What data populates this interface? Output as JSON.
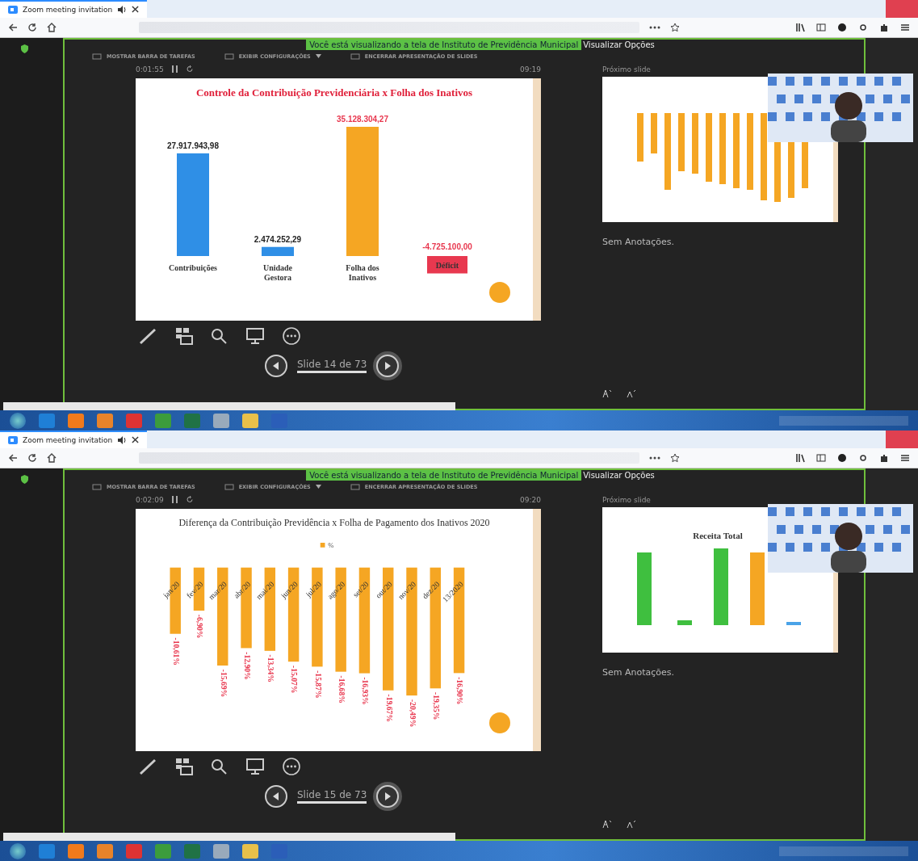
{
  "screens": [
    {
      "browser": {
        "tab_title": "Zoom meeting invitation"
      },
      "share_banner": "Você está visualizando a tela de Instituto de Previdência Municipal",
      "view_options": "Visualizar Opções",
      "controls": [
        "MOSTRAR BARRA DE TAREFAS",
        "EXIBIR CONFIGURAÇÕES",
        "ENCERRAR APRESENTAÇÃO DE SLIDES"
      ],
      "timer": "0:01:55",
      "clock": "09:19",
      "slide": {
        "kind": "summary",
        "chart_data": {
          "type": "bar",
          "title": "Controle da Contribuição Previdenciária x Folha dos Inativos",
          "categories": [
            "Contribuições",
            "Unidade Gestora",
            "Folha dos Inativos",
            "Déficit"
          ],
          "series": [
            {
              "color": "#2f8fe6",
              "values": [
                27917943.98,
                2474252.29,
                null,
                null
              ],
              "value_labels": [
                "27.917.943,98",
                "2.474.252,29",
                null,
                null
              ]
            },
            {
              "color": "#f5a623",
              "values": [
                null,
                null,
                35128304.27,
                null
              ],
              "value_labels": [
                null,
                null,
                "35.128.304,27",
                null
              ]
            },
            {
              "color": "#e8384f",
              "values": [
                null,
                null,
                null,
                -4725100.0
              ],
              "value_labels": [
                null,
                null,
                null,
                "-4.725.100,00"
              ]
            }
          ]
        }
      },
      "slide_counter": "Slide 14 de 73",
      "next_slide": {
        "label": "Próximo slide",
        "kind": "monthly-bars"
      },
      "notes": "Sem Anotações."
    },
    {
      "browser": {
        "tab_title": "Zoom meeting invitation"
      },
      "share_banner": "Você está visualizando a tela de Instituto de Previdência Municipal",
      "view_options": "Visualizar Opções",
      "controls": [
        "MOSTRAR BARRA DE TAREFAS",
        "EXIBIR CONFIGURAÇÕES",
        "ENCERRAR APRESENTAÇÃO DE SLIDES"
      ],
      "timer": "0:02:09",
      "clock": "09:20",
      "slide": {
        "kind": "monthly",
        "chart_data": {
          "type": "bar",
          "title": "Diferença da Contribuição Previdência x Folha de Pagamento dos Inativos 2020",
          "categories": [
            "jan/20",
            "fev/20",
            "mar/20",
            "abr/20",
            "mai/20",
            "jun/20",
            "jul/20",
            "ago/20",
            "set/20",
            "out/20",
            "nov/20",
            "dez/20",
            "13/2020"
          ],
          "series": [
            {
              "name": "%",
              "color": "#f5a623",
              "values": [
                -10.61,
                -6.9,
                -15.69,
                -12.9,
                -13.34,
                -15.07,
                -15.87,
                -16.68,
                -16.93,
                -19.67,
                -20.49,
                -19.35,
                -16.9
              ],
              "value_labels": [
                "-10,61%",
                "-6,90%",
                "-15,69%",
                "-12,90%",
                "-13,34%",
                "-15,07%",
                "-15,87%",
                "-16,68%",
                "-16,93%",
                "-19,67%",
                "-20,49%",
                "-19,35%",
                "-16,90%"
              ]
            }
          ]
        }
      },
      "slide_counter": "Slide 15 de 73",
      "next_slide": {
        "label": "Próximo slide",
        "kind": "revenue-bars",
        "title": "Receita Total"
      },
      "notes": "Sem Anotações."
    }
  ]
}
